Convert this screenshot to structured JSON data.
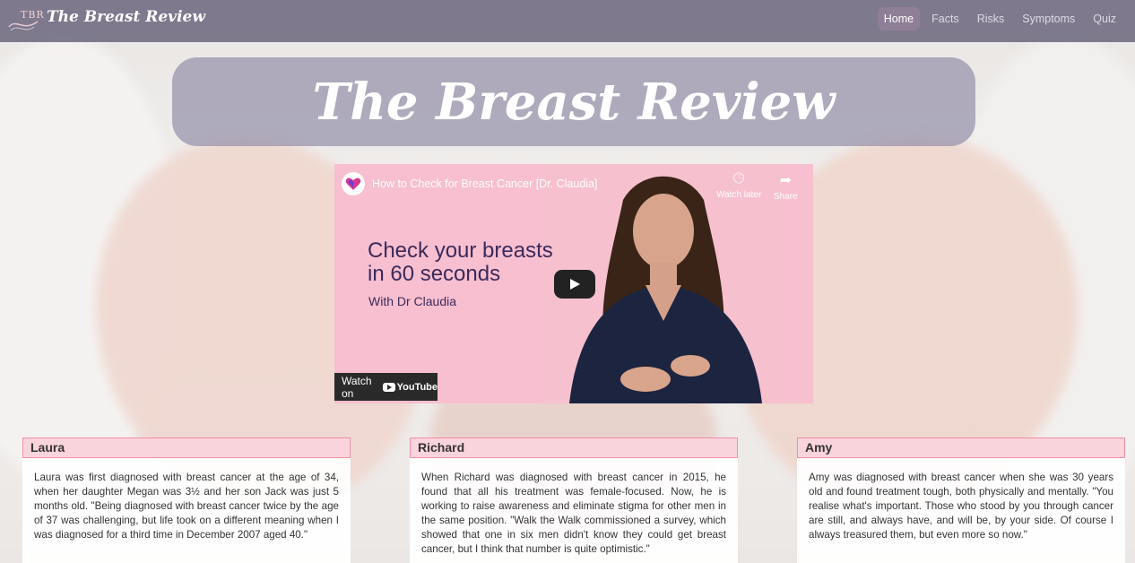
{
  "nav": {
    "logo_text": "TBR",
    "brand": "The Breast Review",
    "links": [
      {
        "label": "Home",
        "active": true
      },
      {
        "label": "Facts"
      },
      {
        "label": "Risks"
      },
      {
        "label": "Symptoms"
      },
      {
        "label": "Quiz"
      }
    ]
  },
  "hero": {
    "title": "The Breast Review"
  },
  "video": {
    "title": "How to Check for Breast Cancer [Dr. Claudia]",
    "headline_line1": "Check your breasts",
    "headline_line2": "in 60 seconds",
    "subtitle": "With Dr Claudia",
    "watch_later": "Watch later",
    "share": "Share",
    "watch_on": "Watch on",
    "platform": "YouTube"
  },
  "stories": [
    {
      "name": "Laura",
      "text": "Laura was first diagnosed with breast cancer at the age of 34, when her daughter Megan was 3½ and her son Jack was just 5 months old. \"Being diagnosed with breast cancer twice by the age of 37 was challenging, but life took on a different meaning when I was diagnosed for a third time in December 2007 aged 40.\""
    },
    {
      "name": "Richard",
      "text": "When Richard was diagnosed with breast cancer in 2015, he found that all his treatment was female-focused. Now, he is working to raise awareness and eliminate stigma for other men in the same position. \"Walk the Walk commissioned a survey, which showed that one in six men didn't know they could get breast cancer, but I think that number is quite optimistic.\""
    },
    {
      "name": "Amy",
      "text": "Amy was diagnosed with breast cancer when she was 30 years old and found treatment tough, both physically and mentally. \"You realise what's important. Those who stood by you through cancer are still, and always have, and will be, by your side. Of course I always treasured them, but even more so now.\""
    }
  ]
}
